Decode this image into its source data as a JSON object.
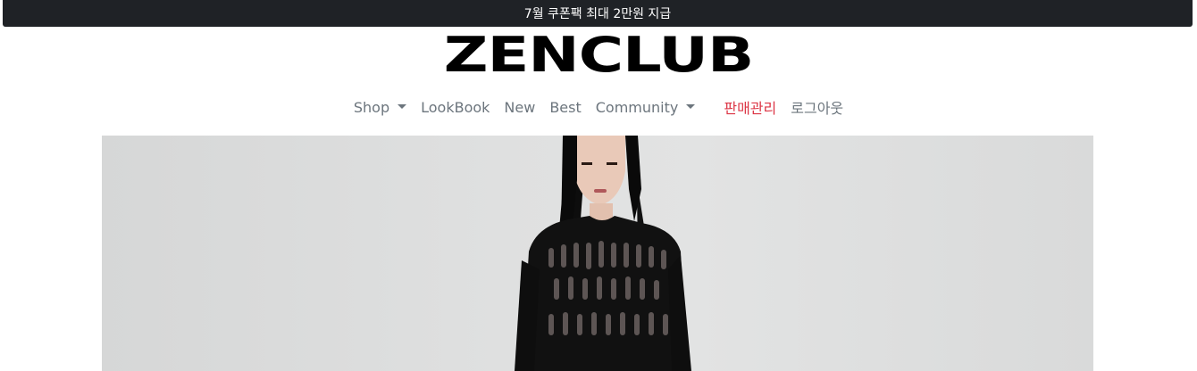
{
  "banner": {
    "text": "7월 쿠폰팩 최대 2만원 지급"
  },
  "brand": {
    "name": "ZENCLUB"
  },
  "nav": {
    "shop": "Shop",
    "lookbook": "LookBook",
    "new": "New",
    "best": "Best",
    "community": "Community",
    "admin": "판매관리",
    "logout": "로그아웃"
  },
  "hero": {
    "alt": "model wearing black open-knit sweater"
  },
  "colors": {
    "banner_bg": "#1f2226",
    "nav_text": "#6c757d",
    "admin_text": "#dc3545",
    "hero_bg": "#dedfdf"
  }
}
